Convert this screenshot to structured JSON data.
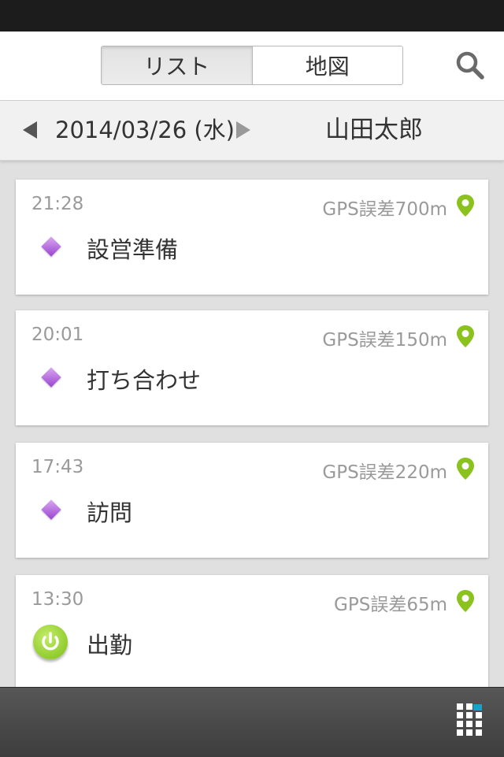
{
  "tabs": [
    {
      "label": "リスト",
      "active": true
    },
    {
      "label": "地図",
      "active": false
    }
  ],
  "date_bar": {
    "date": "2014/03/26 (水)",
    "user": "山田太郎"
  },
  "entries": [
    {
      "time": "21:28",
      "gps": "GPS誤差700m",
      "label": "設営準備",
      "icon": "diamond-icon"
    },
    {
      "time": "20:01",
      "gps": "GPS誤差150m",
      "label": "打ち合わせ",
      "icon": "diamond-icon"
    },
    {
      "time": "17:43",
      "gps": "GPS誤差220m",
      "label": "訪問",
      "icon": "diamond-icon"
    },
    {
      "time": "13:30",
      "gps": "GPS誤差65m",
      "label": "出勤",
      "icon": "power-icon"
    }
  ],
  "colors": {
    "accent_green": "#8cc21e",
    "diamond_purple": "#b06ad9",
    "grid_accent": "#1aa0c8"
  }
}
